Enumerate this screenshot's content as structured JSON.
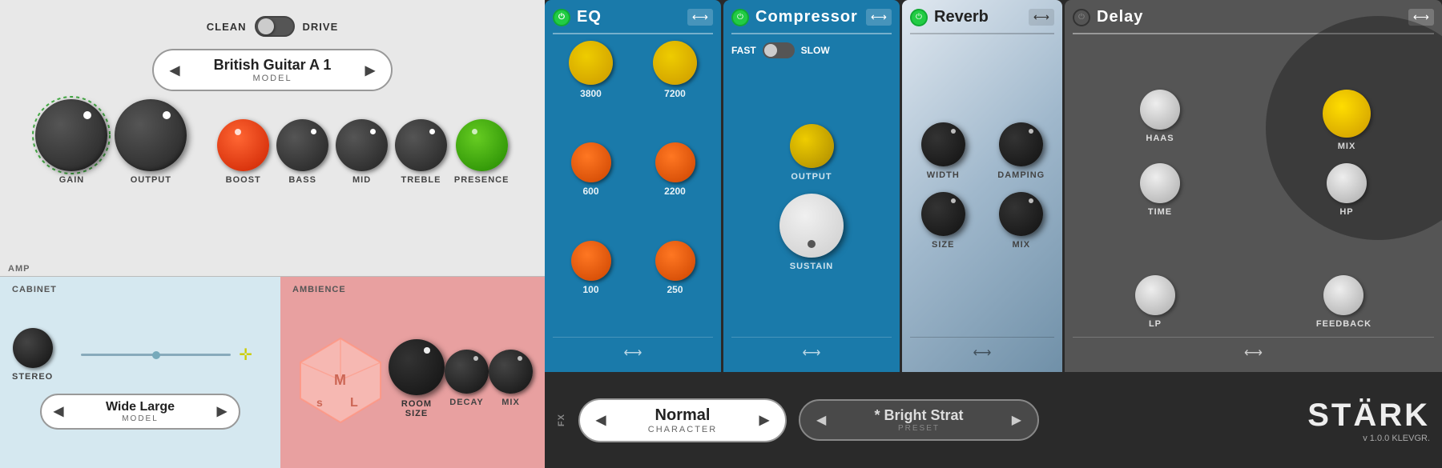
{
  "amp": {
    "mode_left": "CLEAN",
    "mode_right": "DRIVE",
    "model_name": "British Guitar A 1",
    "model_sub": "MODEL",
    "model_arrow_left": "◀",
    "model_arrow_right": "▶",
    "knobs": [
      {
        "id": "gain",
        "label": "GAIN",
        "color": "large"
      },
      {
        "id": "output",
        "label": "OUTPUT",
        "color": "large-dark"
      },
      {
        "id": "boost",
        "label": "BOOST",
        "color": "boost"
      },
      {
        "id": "bass",
        "label": "BASS",
        "color": "medium"
      },
      {
        "id": "mid",
        "label": "MID",
        "color": "medium"
      },
      {
        "id": "treble",
        "label": "TREBLE",
        "color": "medium"
      },
      {
        "id": "presence",
        "label": "PRESENCE",
        "color": "presence"
      }
    ],
    "amp_label": "AMP"
  },
  "cabinet": {
    "label": "CABINET",
    "stereo_label": "STEREO",
    "model_name": "Wide Large",
    "model_sub": "MODEL",
    "arrow_left": "◀",
    "arrow_right": "▶"
  },
  "ambience": {
    "label": "AMBIENCE",
    "knobs": [
      {
        "id": "room-size",
        "label": "ROOM\nSIZE"
      },
      {
        "id": "decay",
        "label": "DECAY"
      },
      {
        "id": "mix",
        "label": "MIX"
      }
    ]
  },
  "fx": {
    "label": "FX",
    "eq": {
      "title": "EQ",
      "power": true,
      "bands": [
        {
          "freq": "3800",
          "color": "yellow"
        },
        {
          "freq": "7200",
          "color": "yellow"
        },
        {
          "freq": "600",
          "color": "orange"
        },
        {
          "freq": "2200",
          "color": "orange"
        },
        {
          "freq": "100",
          "color": "orange"
        },
        {
          "freq": "250",
          "color": "orange"
        }
      ]
    },
    "compressor": {
      "title": "Compressor",
      "power": true,
      "speed_left": "FAST",
      "speed_right": "SLOW",
      "output_label": "OUTPUT",
      "sustain_label": "SUSTAIN"
    },
    "reverb": {
      "title": "Reverb",
      "power": true,
      "knobs": [
        {
          "id": "width",
          "label": "WIDTH"
        },
        {
          "id": "damping",
          "label": "DAMPING"
        },
        {
          "id": "size",
          "label": "SIZE"
        },
        {
          "id": "mix",
          "label": "MIX"
        }
      ]
    },
    "delay": {
      "title": "Delay",
      "power": true,
      "knobs": [
        {
          "id": "haas",
          "label": "HAAS"
        },
        {
          "id": "mix",
          "label": "MIX"
        },
        {
          "id": "time",
          "label": "TIME"
        },
        {
          "id": "hp",
          "label": "HP"
        },
        {
          "id": "lp",
          "label": "LP"
        },
        {
          "id": "feedback",
          "label": "FEEDBACK"
        }
      ]
    }
  },
  "character": {
    "name": "Normal",
    "sub": "CHARACTER",
    "arrow_left": "◀",
    "arrow_right": "▶"
  },
  "preset": {
    "name": "* Bright Strat",
    "sub": "PRESET",
    "arrow_left": "◀",
    "arrow_right": "▶"
  },
  "branding": {
    "logo": "STÄRK",
    "version": "v 1.0.0",
    "maker": "KLEVGR."
  }
}
